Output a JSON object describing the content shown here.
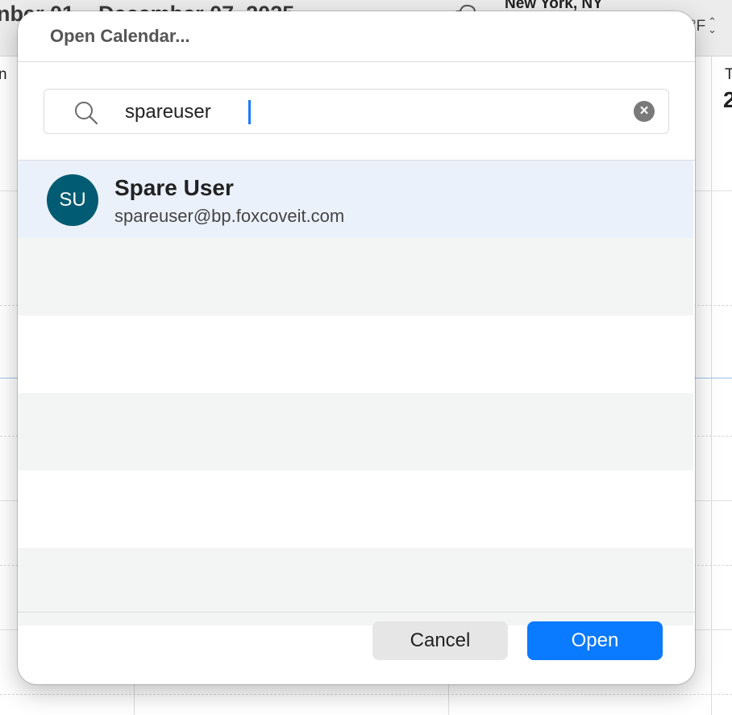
{
  "background": {
    "date_range": "nber 01 – December 07, 2025",
    "weather_location": "New York, NY",
    "temperature_unit": "°F",
    "day_left": "n",
    "day_right": "T",
    "day_right_num": "2"
  },
  "dialog": {
    "title": "Open Calendar...",
    "search": {
      "value": "spareuser",
      "placeholder": ""
    },
    "results": [
      {
        "initials": "SU",
        "name": "Spare User",
        "email": "spareuser@bp.foxcoveit.com",
        "avatar_color": "#005b73"
      }
    ],
    "buttons": {
      "cancel": "Cancel",
      "open": "Open"
    }
  },
  "colors": {
    "accent": "#0a7aff",
    "selected_row": "#eaf1fb",
    "alt_row": "#f3f4f4"
  }
}
